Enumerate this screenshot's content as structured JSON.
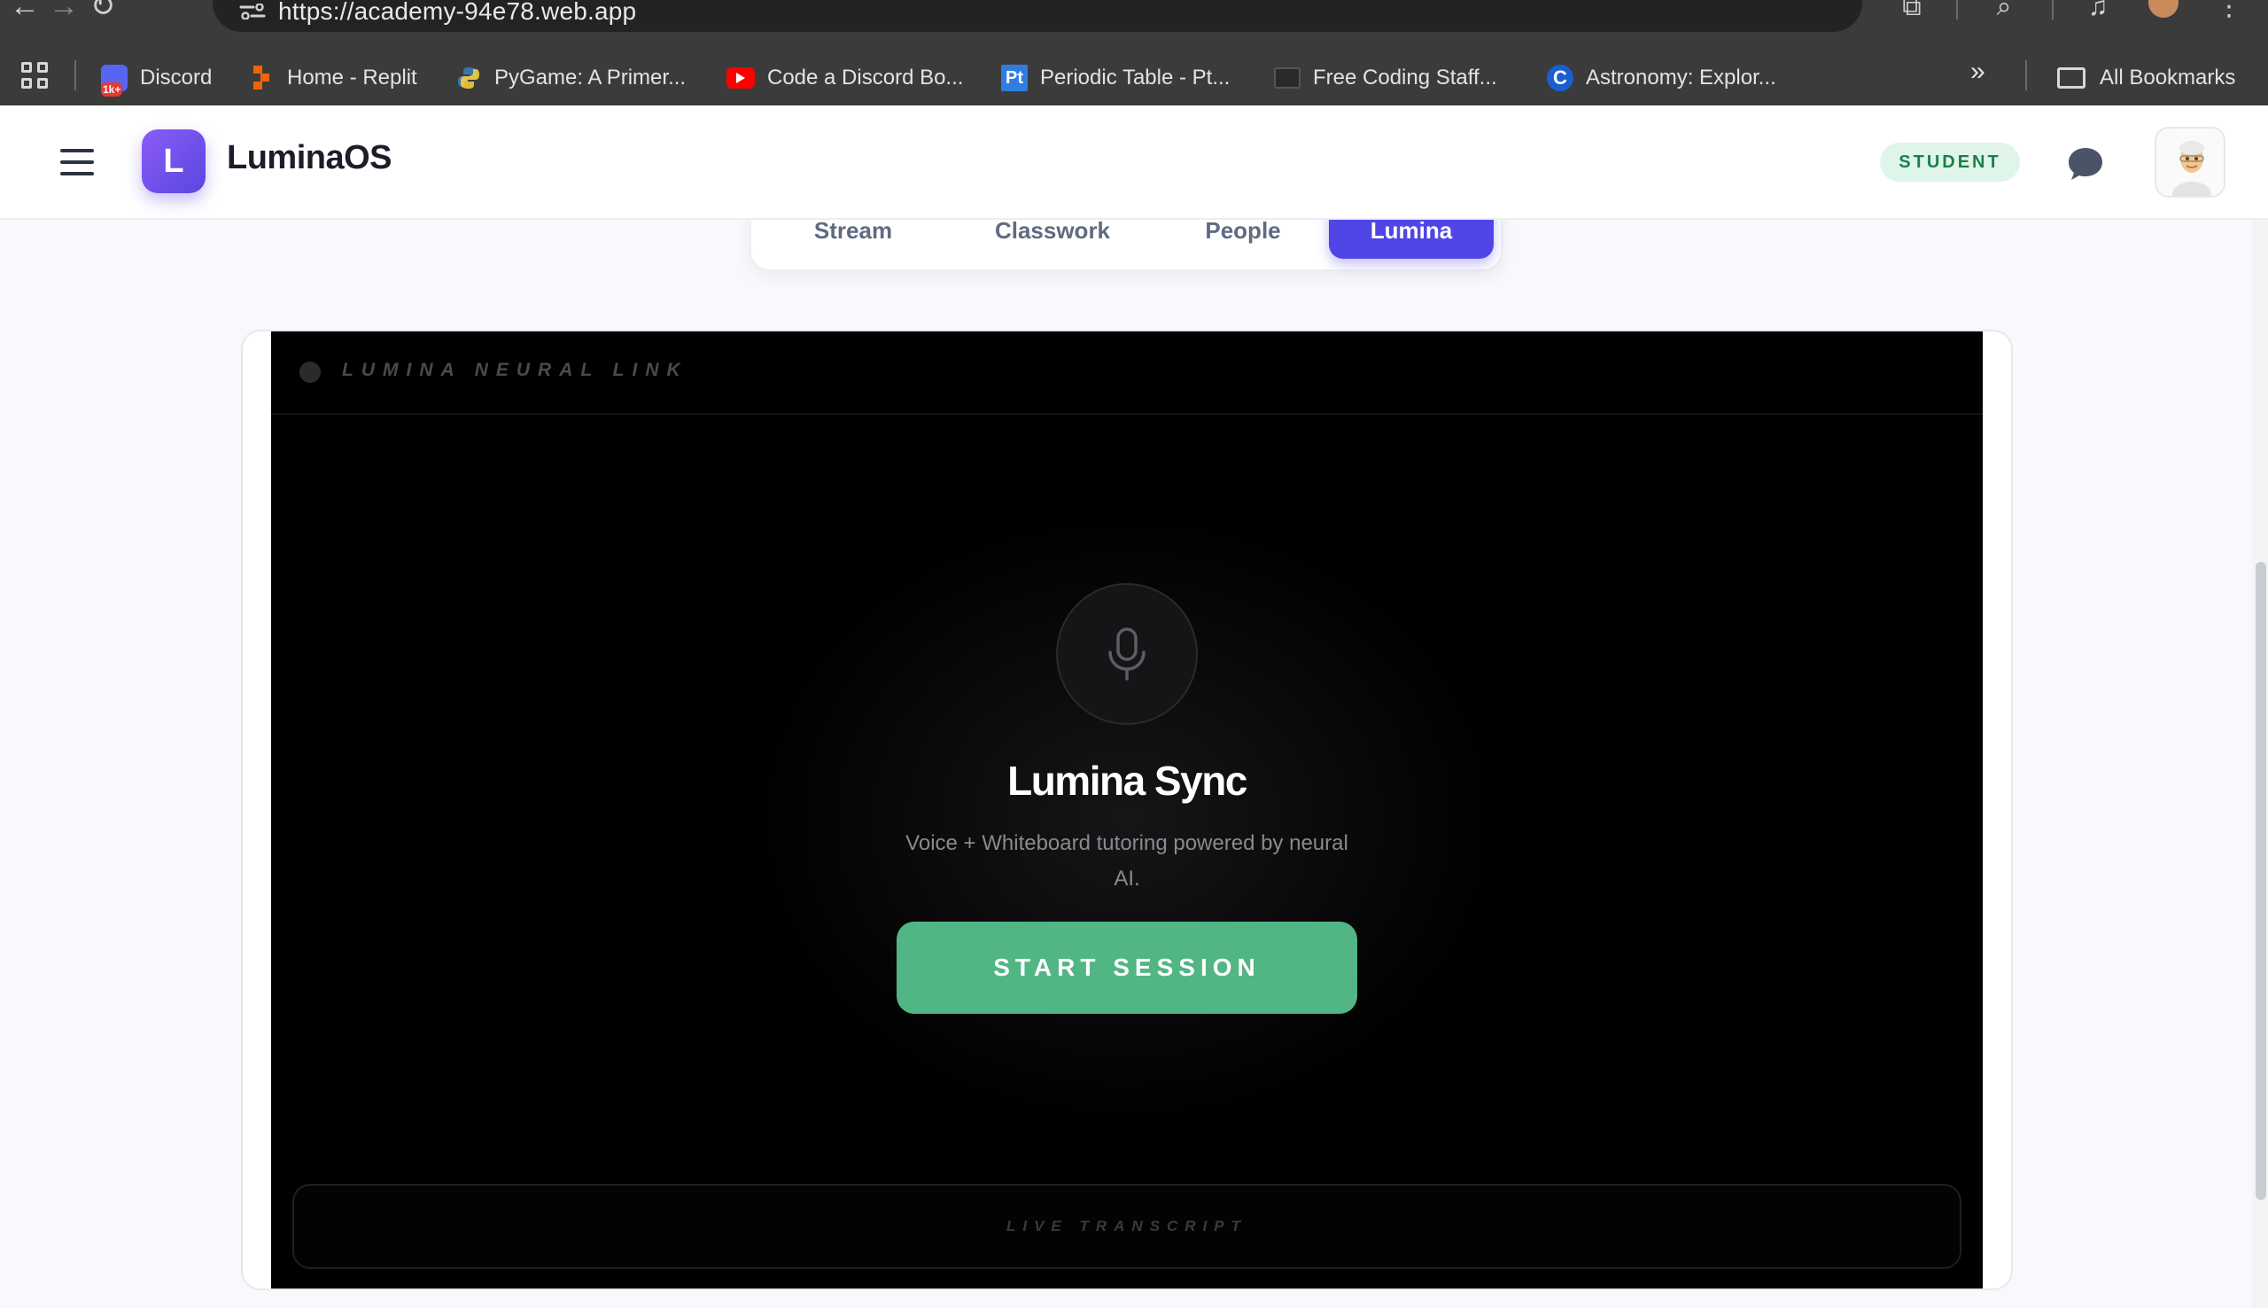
{
  "browser": {
    "url": "https://academy-94e78.web.app",
    "bookmarks": [
      {
        "label": "Discord",
        "icon": "discord-icon",
        "color": "#5865f2"
      },
      {
        "label": "Home - Replit",
        "icon": "replit-icon",
        "color": "#f26207"
      },
      {
        "label": "PyGame: A Primer...",
        "icon": "python-icon",
        "color": "#3776ab"
      },
      {
        "label": "Code a Discord Bo...",
        "icon": "youtube-icon",
        "color": "#ff0000"
      },
      {
        "label": "Periodic Table - Pt...",
        "icon": "pt-icon",
        "color": "#2f7de1"
      },
      {
        "label": "Free Coding Staff...",
        "icon": "monitor-icon",
        "color": "#555555"
      },
      {
        "label": "Astronomy: Explor...",
        "icon": "c-icon",
        "color": "#1a5fd1"
      }
    ],
    "all_bookmarks_label": "All Bookmarks",
    "discord_badge": "1k+",
    "pt_badge": "Pt",
    "c_badge": "C"
  },
  "header": {
    "logo_letter": "L",
    "brand": "LuminaOS",
    "role_badge": "STUDENT"
  },
  "tabs": [
    {
      "label": "Stream",
      "active": false
    },
    {
      "label": "Classwork",
      "active": false
    },
    {
      "label": "People",
      "active": false
    },
    {
      "label": "Lumina",
      "active": true
    }
  ],
  "lumina": {
    "panel_title": "LUMINA NEURAL LINK",
    "title": "Lumina Sync",
    "subtitle": "Voice + Whiteboard tutoring powered by neural AI.",
    "start_button": "START SESSION",
    "transcript_label": "LIVE TRANSCRIPT",
    "accent_color": "#52b584",
    "tab_active_color": "#4f46e5"
  }
}
